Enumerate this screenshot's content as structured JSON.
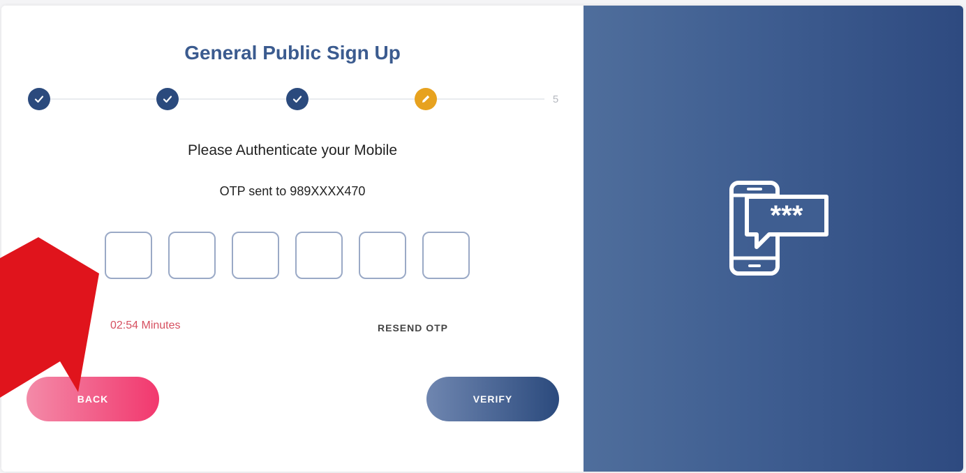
{
  "form": {
    "title": "General Public Sign Up",
    "heading": "Please Authenticate your Mobile",
    "otp_sent_text": "OTP sent to 989XXXX470",
    "timer_text": "02:54 Minutes",
    "resend_label": "RESEND OTP",
    "back_label": "BACK",
    "verify_label": "VERIFY"
  },
  "stepper": {
    "steps": [
      {
        "state": "done",
        "icon": "check-icon"
      },
      {
        "state": "done",
        "icon": "check-icon"
      },
      {
        "state": "done",
        "icon": "check-icon"
      },
      {
        "state": "active",
        "icon": "pencil-icon"
      },
      {
        "state": "pending",
        "label": "5"
      }
    ]
  },
  "otp": {
    "digits": [
      "",
      "",
      "",
      "",
      "",
      ""
    ]
  },
  "illustration": {
    "icon": "phone-otp-icon"
  },
  "annotation": {
    "icon": "red-arrow-icon"
  },
  "colors": {
    "primary": "#2b4a7d",
    "title": "#3b5b8f",
    "active_step": "#e7a21f",
    "timer": "#d65060",
    "back_button": "#f2386e",
    "arrow": "#e0141c"
  }
}
